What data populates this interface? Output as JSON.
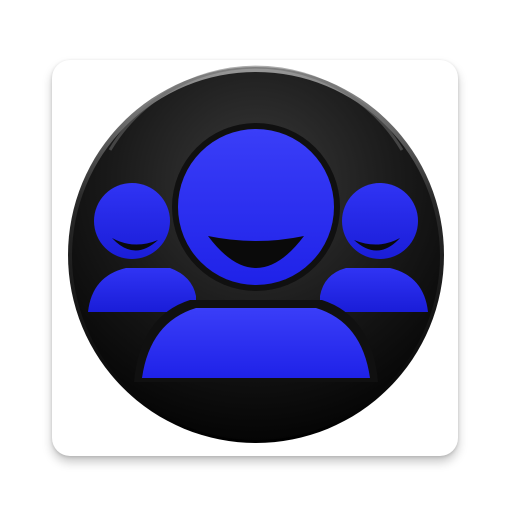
{
  "app_icon": {
    "name": "group-contacts-icon",
    "colors": {
      "tile": "#ffffff",
      "disc_dark": "#0d0d0d",
      "disc_light": "#4a4a4a",
      "figures": "#2a2ef2",
      "figures_dark": "#1a1dc8"
    }
  }
}
